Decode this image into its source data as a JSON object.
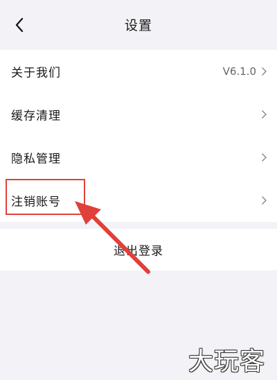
{
  "header": {
    "title": "设置",
    "back_icon": "chevron-left-icon"
  },
  "settings": {
    "items": [
      {
        "label": "关于我们",
        "value": "V6.1.0"
      },
      {
        "label": "缓存清理",
        "value": ""
      },
      {
        "label": "隐私管理",
        "value": ""
      },
      {
        "label": "注销账号",
        "value": ""
      }
    ]
  },
  "logout": {
    "label": "退出登录"
  },
  "annotation": {
    "highlight_color": "#e0403a",
    "highlighted_item": "注销账号"
  },
  "watermark": {
    "text": "大玩客"
  }
}
